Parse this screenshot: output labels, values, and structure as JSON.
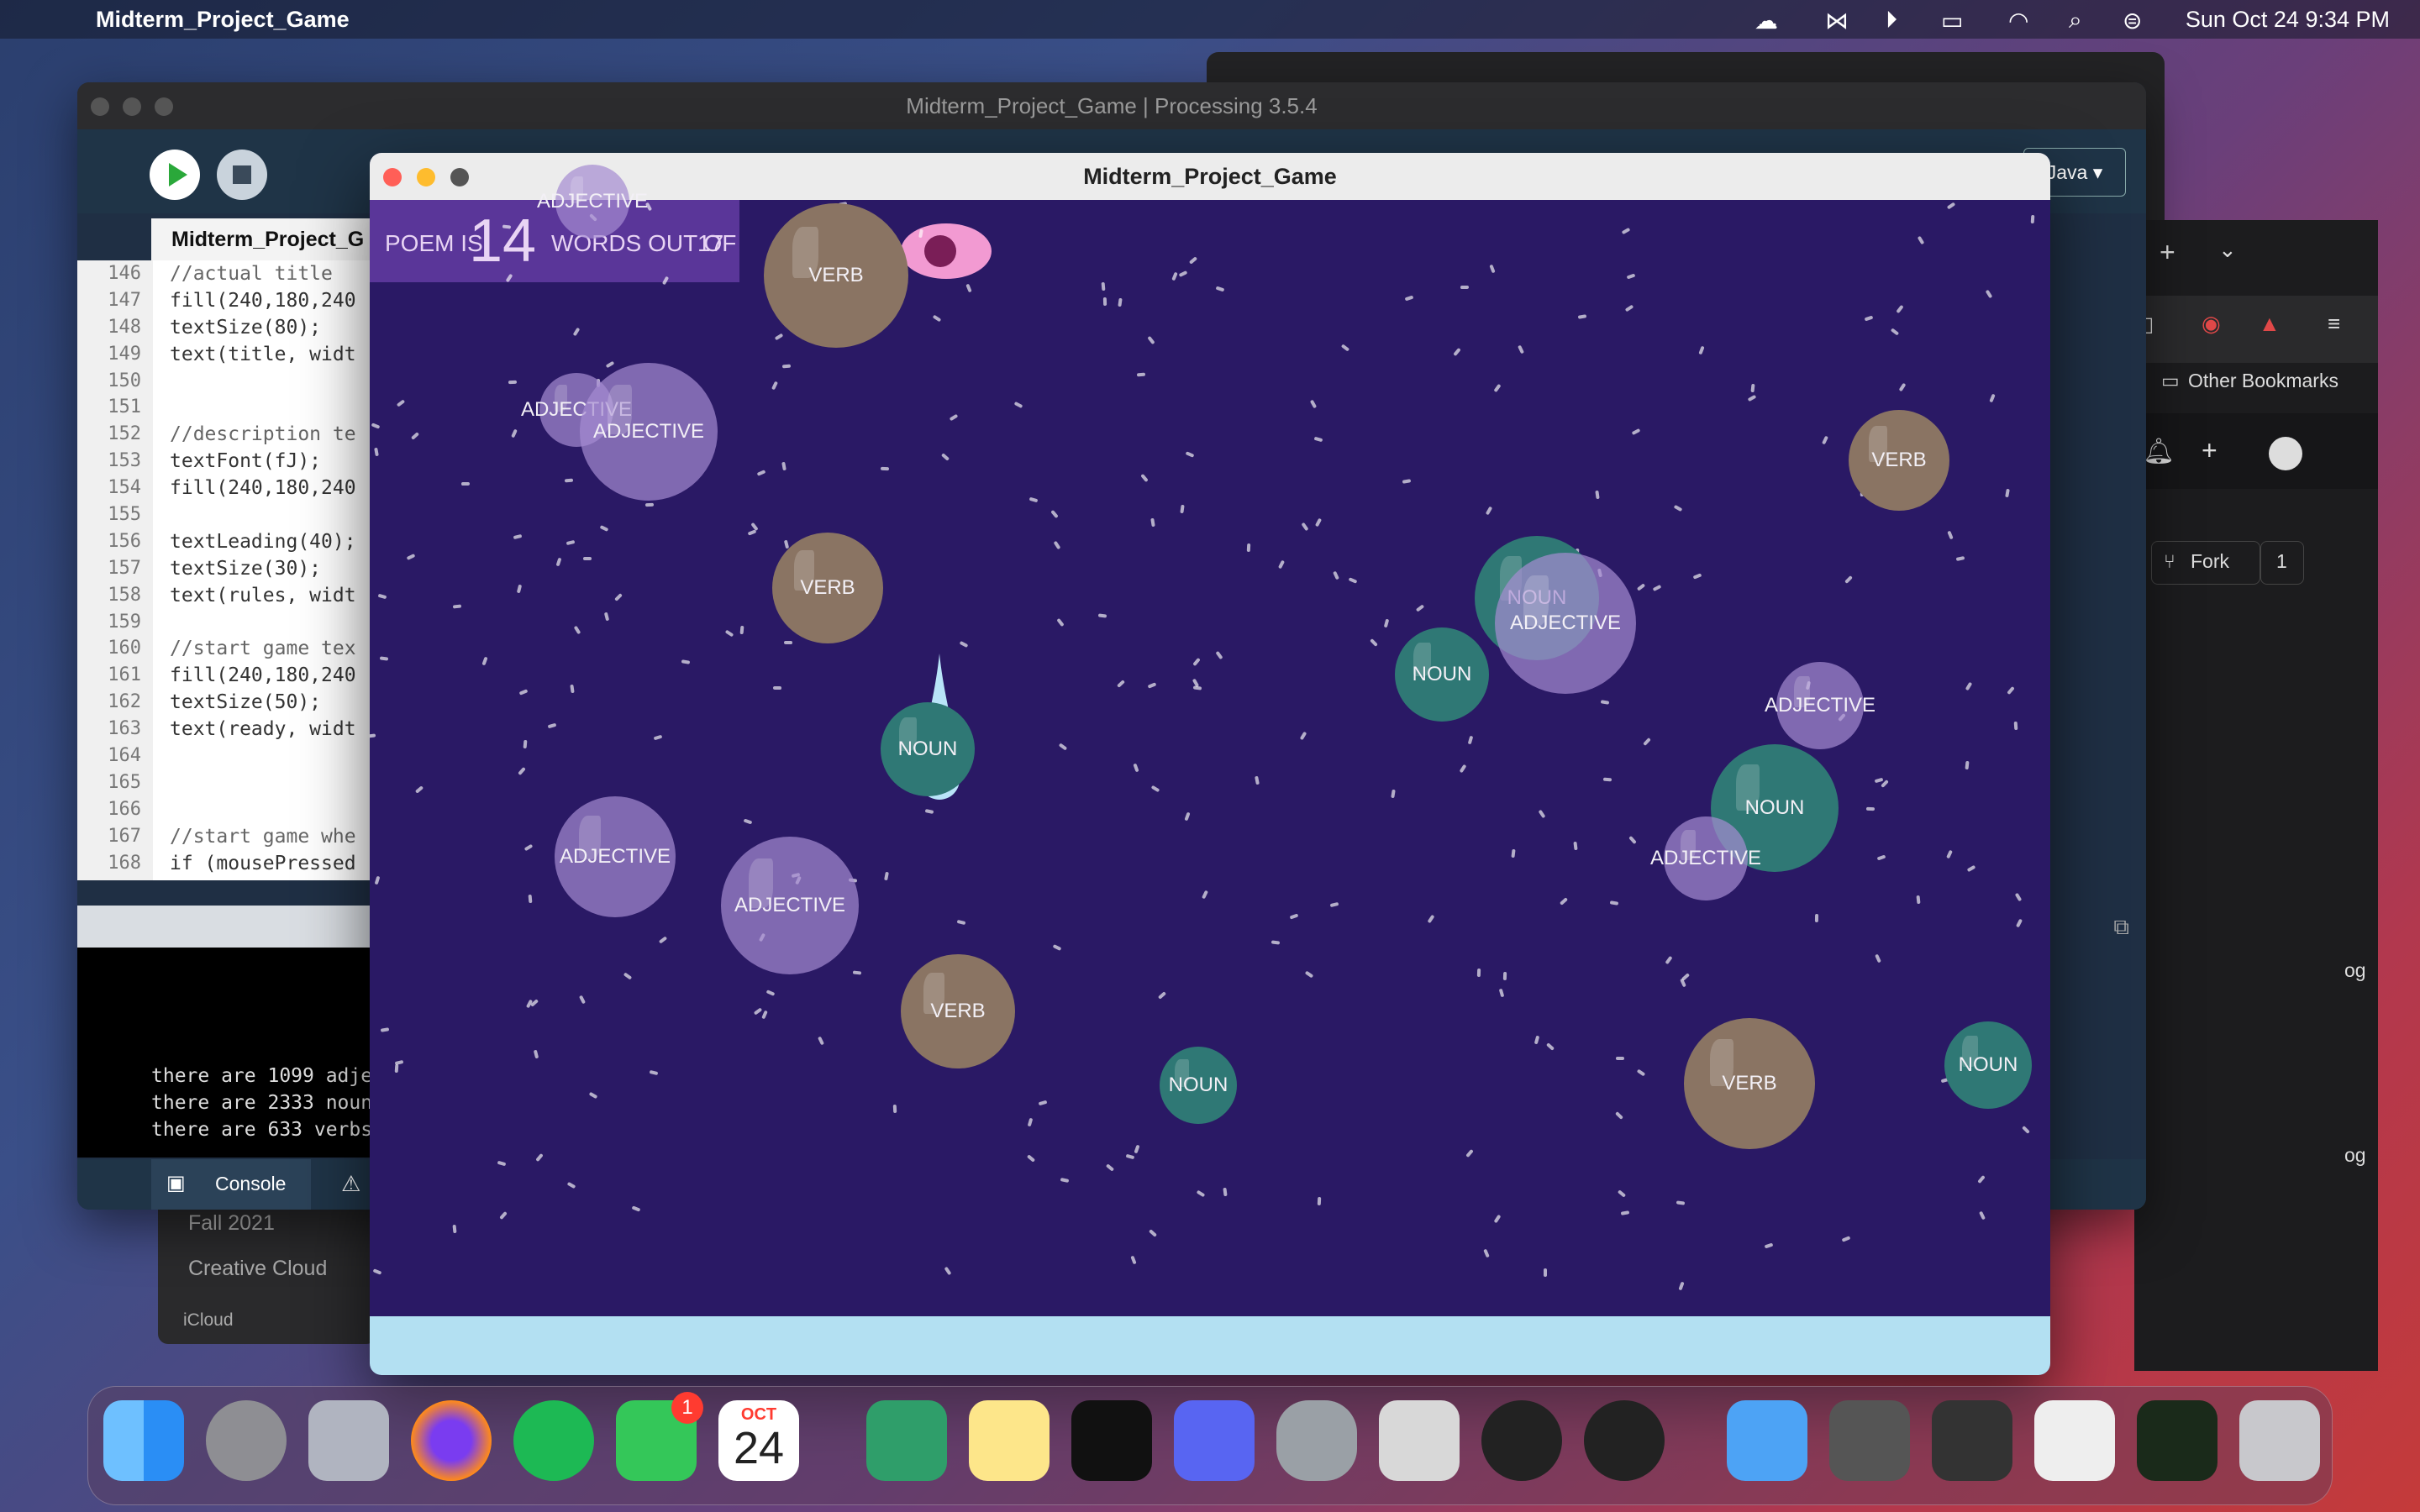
{
  "menubar": {
    "app_name": "Midterm_Project_Game",
    "datetime": "Sun Oct 24  9:34 PM"
  },
  "ide": {
    "window_title": "Midterm_Project_Game | Processing 3.5.4",
    "tab_label": "Midterm_Project_G",
    "mode_label": "Java ▾",
    "code_lines": [
      {
        "num": "146",
        "text": "//actual title"
      },
      {
        "num": "147",
        "text": "fill(240,180,240"
      },
      {
        "num": "148",
        "text": "textSize(80);"
      },
      {
        "num": "149",
        "text": "text(title, widt"
      },
      {
        "num": "150",
        "text": ""
      },
      {
        "num": "151",
        "text": ""
      },
      {
        "num": "152",
        "text": "//description te"
      },
      {
        "num": "153",
        "text": "textFont(fJ);"
      },
      {
        "num": "154",
        "text": "fill(240,180,240"
      },
      {
        "num": "155",
        "text": ""
      },
      {
        "num": "156",
        "text": "textLeading(40);"
      },
      {
        "num": "157",
        "text": "textSize(30);"
      },
      {
        "num": "158",
        "text": "text(rules, widt"
      },
      {
        "num": "159",
        "text": ""
      },
      {
        "num": "160",
        "text": "//start game tex"
      },
      {
        "num": "161",
        "text": "fill(240,180,240"
      },
      {
        "num": "162",
        "text": "textSize(50);"
      },
      {
        "num": "163",
        "text": "text(ready, widt"
      },
      {
        "num": "164",
        "text": ""
      },
      {
        "num": "165",
        "text": ""
      },
      {
        "num": "166",
        "text": ""
      },
      {
        "num": "167",
        "text": "//start game whe"
      },
      {
        "num": "168",
        "text": "if (mousePressed"
      }
    ],
    "console_lines": [
      "there are 1099 adje",
      "there are 2333 noun",
      "there are 633 verbs"
    ],
    "console_tab": "Console"
  },
  "browser": {
    "bookmarks_label": "Other Bookmarks",
    "fork_label": "Fork",
    "fork_count": "1",
    "side_text_1": "og",
    "side_text_2": "og"
  },
  "finder": {
    "item_1": "Fall 2021",
    "item_2": "Creative Cloud",
    "section": "iCloud"
  },
  "game": {
    "window_title": "Midterm_Project_Game",
    "score_prefix": "POEM IS",
    "score_value": "14",
    "score_suffix": "WORDS OUT OF",
    "score_total": "17",
    "bubbles": [
      {
        "label": "ADJECTIVE",
        "kind": "adj"
      },
      {
        "label": "ADJECTIVE",
        "kind": "adj"
      },
      {
        "label": "ADJECTIVE",
        "kind": "adj"
      },
      {
        "label": "VERB",
        "kind": "verb"
      },
      {
        "label": "VERB",
        "kind": "verb"
      },
      {
        "label": "NOUN",
        "kind": "noun"
      },
      {
        "label": "NOUN",
        "kind": "noun"
      },
      {
        "label": "ADJECTIVE",
        "kind": "adj"
      },
      {
        "label": "NOUN",
        "kind": "noun"
      },
      {
        "label": "VERB",
        "kind": "verb"
      },
      {
        "label": "ADJECTIVE",
        "kind": "adj"
      },
      {
        "label": "NOUN",
        "kind": "noun"
      },
      {
        "label": "ADJECTIVE",
        "kind": "adj"
      },
      {
        "label": "ADJECTIVE",
        "kind": "adj"
      },
      {
        "label": "ADJECTIVE",
        "kind": "adj"
      },
      {
        "label": "VERB",
        "kind": "verb"
      },
      {
        "label": "NOUN",
        "kind": "noun"
      },
      {
        "label": "VERB",
        "kind": "verb"
      },
      {
        "label": "NOUN",
        "kind": "noun"
      }
    ]
  },
  "dock": {
    "calendar_month": "OCT",
    "calendar_day": "24",
    "messages_badge": "1"
  }
}
